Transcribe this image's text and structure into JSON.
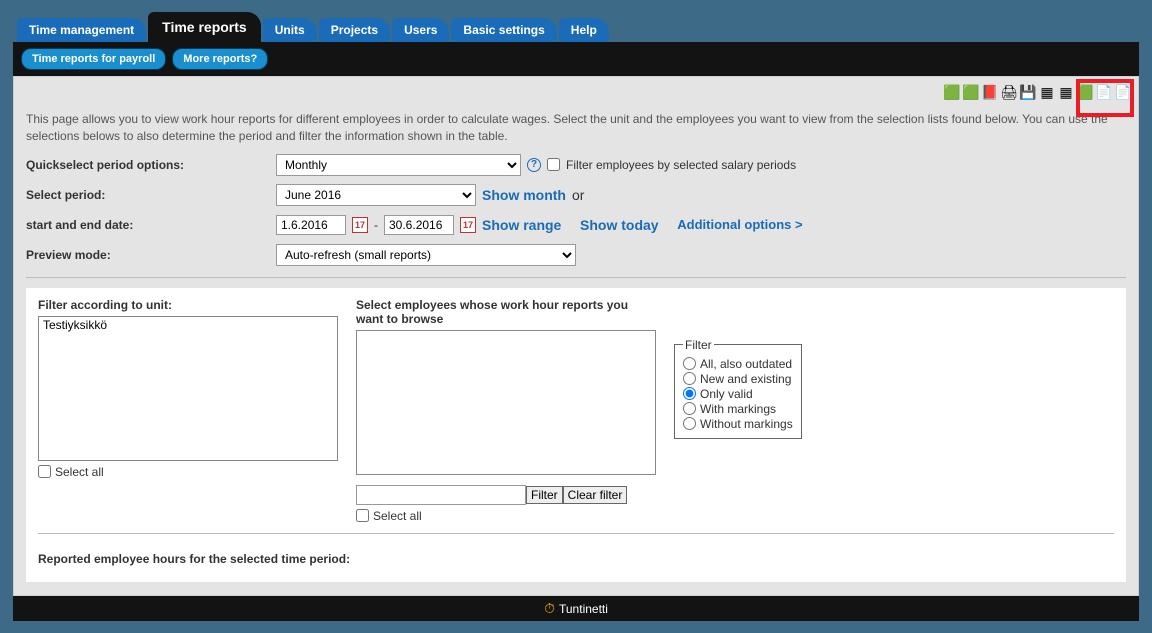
{
  "nav": {
    "tabs": [
      "Time management",
      "Time reports",
      "Units",
      "Projects",
      "Users",
      "Basic settings",
      "Help"
    ],
    "active": 1
  },
  "subnav": {
    "pills": [
      "Time reports for payroll",
      "More reports?"
    ]
  },
  "toolbar": {
    "icons": [
      {
        "name": "excel-export-icon",
        "glyph": "🟩"
      },
      {
        "name": "excel-export2-icon",
        "glyph": "🟩"
      },
      {
        "name": "pdf-export-icon",
        "glyph": "📕"
      },
      {
        "name": "print-icon",
        "glyph": "🖨"
      },
      {
        "name": "save-icon",
        "glyph": "💾"
      },
      {
        "name": "grid-icon",
        "glyph": "▦"
      },
      {
        "name": "grid2-icon",
        "glyph": "▦"
      },
      {
        "name": "excel-batch-icon",
        "glyph": "🟩"
      },
      {
        "name": "csv-export-icon",
        "glyph": "📄"
      },
      {
        "name": "xml-export-icon",
        "glyph": "📄"
      }
    ]
  },
  "intro": "This page allows you to view work hour reports for different employees in order to calculate wages. Select the unit and the employees you want to view from the selection lists found below. You can use the selections belows to also determine the period and filter the information shown in the table.",
  "opts": {
    "quickselect_label": "Quickselect period options:",
    "quickselect_value": "Monthly",
    "quickselect_options": [
      "Monthly"
    ],
    "filter_salary_label": "Filter employees by selected salary periods",
    "select_period_label": "Select period:",
    "select_period_value": "June 2016",
    "select_period_options": [
      "June 2016"
    ],
    "show_month": "Show month",
    "or": "or",
    "start_end_label": "start and end date:",
    "start_date": "1.6.2016",
    "end_date": "30.6.2016",
    "show_range": "Show range",
    "show_today": "Show today",
    "additional": "Additional options >",
    "preview_label": "Preview mode:",
    "preview_value": "Auto-refresh (small reports)",
    "preview_options": [
      "Auto-refresh (small reports)"
    ]
  },
  "filters": {
    "unit_label": "Filter according to unit:",
    "unit_items": [
      "Testiyksikkö"
    ],
    "unit_selectall": "Select all",
    "emp_label": "Select employees whose work hour reports you want to browse",
    "emp_selectall": "Select all",
    "filter_btn": "Filter",
    "clear_filter_btn": "Clear filter",
    "radio_legend": "Filter",
    "radio": [
      {
        "label": "All, also outdated",
        "checked": false
      },
      {
        "label": "New and existing",
        "checked": false
      },
      {
        "label": "Only valid",
        "checked": true
      },
      {
        "label": "With markings",
        "checked": false
      },
      {
        "label": "Without markings",
        "checked": false
      }
    ]
  },
  "reported_label": "Reported employee hours for the selected time period:",
  "footer": {
    "brand": "Tuntinetti"
  }
}
